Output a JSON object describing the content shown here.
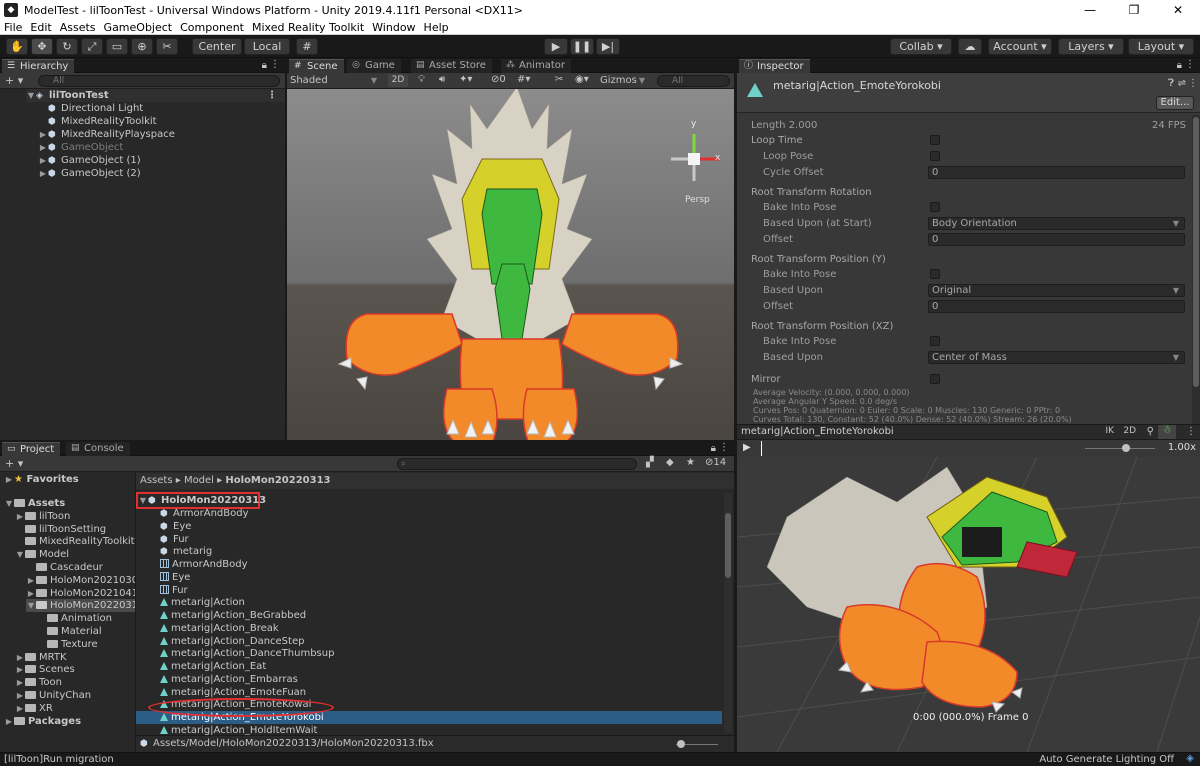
{
  "window": {
    "title": "ModelTest - lilToonTest - Universal Windows Platform - Unity 2019.4.11f1 Personal <DX11>",
    "minimize": "—",
    "maximize": "❐",
    "close": "✕"
  },
  "menu": [
    "File",
    "Edit",
    "Assets",
    "GameObject",
    "Component",
    "Mixed Reality Toolkit",
    "Window",
    "Help"
  ],
  "toolbar": {
    "center_label": "Center",
    "local_label": "Local",
    "collab_label": "Collab ▾",
    "account_label": "Account",
    "layers_label": "Layers",
    "layout_label": "Layout"
  },
  "hierarchy": {
    "tab": "Hierarchy",
    "add": "+ ▾",
    "search_placeholder": "All",
    "scene": "lilToonTest",
    "items": [
      {
        "label": "Directional Light",
        "level": 2,
        "arrow": "",
        "dim": false
      },
      {
        "label": "MixedRealityToolkit",
        "level": 2,
        "arrow": "",
        "dim": false
      },
      {
        "label": "MixedRealityPlayspace",
        "level": 2,
        "arrow": "▶",
        "dim": false
      },
      {
        "label": "GameObject",
        "level": 2,
        "arrow": "▶",
        "dim": true
      },
      {
        "label": "GameObject (1)",
        "level": 2,
        "arrow": "▶",
        "dim": false
      },
      {
        "label": "GameObject (2)",
        "level": 2,
        "arrow": "▶",
        "dim": false
      }
    ]
  },
  "scene_view": {
    "tabs": [
      "Scene",
      "Game",
      "Asset Store",
      "Animator"
    ],
    "shading": "Shaded",
    "mode_2d": "2D",
    "gizmos": "Gizmos",
    "search_placeholder": "All",
    "hidden_count": "0",
    "persp": "Persp",
    "axis_y": "y",
    "axis_x": "x"
  },
  "inspector": {
    "tab": "Inspector",
    "asset_name": "metarig|Action_EmoteYorokobi",
    "edit_button": "Edit...",
    "length_label": "Length",
    "length_value": "2.000",
    "fps": "24 FPS",
    "loop_time": "Loop Time",
    "loop_pose": "Loop Pose",
    "cycle_offset": "Cycle Offset",
    "cycle_offset_value": "0",
    "rot_header": "Root Transform Rotation",
    "bake_into_pose": "Bake Into Pose",
    "based_upon_start": "Based Upon (at Start)",
    "rot_based_value": "Body Orientation",
    "offset": "Offset",
    "rot_offset_value": "0",
    "posy_header": "Root Transform Position (Y)",
    "based_upon": "Based Upon",
    "posy_based_value": "Original",
    "posy_offset_value": "0",
    "posxz_header": "Root Transform Position (XZ)",
    "posxz_based_value": "Center of Mass",
    "mirror": "Mirror",
    "info": [
      "Average Velocity: (0.000, 0.000, 0.000)",
      "Average Angular Y Speed: 0.0 deg/s",
      "Curves Pos: 0 Quaternion: 0 Euler: 0 Scale: 0 Muscles: 130 Generic: 0 PPtr: 0",
      "Curves Total: 130, Constant: 52 (40.0%) Dense: 52 (40.0%) Stream: 26 (20.0%)"
    ]
  },
  "preview": {
    "title": "metarig|Action_EmoteYorokobi",
    "ik": "IK",
    "mode_2d": "2D",
    "speed": "1.00x",
    "timecode": "0:00 (000.0%) Frame 0"
  },
  "project": {
    "tabs": [
      "Project",
      "Console"
    ],
    "add": "+ ▾",
    "count": "14",
    "breadcrumb": [
      "Assets",
      "Model",
      "HoloMon20220313"
    ],
    "favorites": "Favorites",
    "tree": [
      {
        "label": "Assets",
        "level": 0,
        "arrow": "▼",
        "bold": true
      },
      {
        "label": "lilToon",
        "level": 1,
        "arrow": "▶"
      },
      {
        "label": "lilToonSetting",
        "level": 1,
        "arrow": ""
      },
      {
        "label": "MixedRealityToolkit.",
        "level": 1,
        "arrow": ""
      },
      {
        "label": "Model",
        "level": 1,
        "arrow": "▼"
      },
      {
        "label": "Cascadeur",
        "level": 2,
        "arrow": ""
      },
      {
        "label": "HoloMon2021030",
        "level": 2,
        "arrow": "▶"
      },
      {
        "label": "HoloMon2021041",
        "level": 2,
        "arrow": "▶"
      },
      {
        "label": "HoloMon2022031",
        "level": 2,
        "arrow": "▼",
        "selected": true
      },
      {
        "label": "Animation",
        "level": 3,
        "arrow": ""
      },
      {
        "label": "Material",
        "level": 3,
        "arrow": ""
      },
      {
        "label": "Texture",
        "level": 3,
        "arrow": ""
      },
      {
        "label": "MRTK",
        "level": 1,
        "arrow": "▶"
      },
      {
        "label": "Scenes",
        "level": 1,
        "arrow": "▶"
      },
      {
        "label": "Toon",
        "level": 1,
        "arrow": "▶"
      },
      {
        "label": "UnityChan",
        "level": 1,
        "arrow": "▶"
      },
      {
        "label": "XR",
        "level": 1,
        "arrow": "▶"
      },
      {
        "label": "Packages",
        "level": 0,
        "arrow": "▶",
        "bold": true
      }
    ],
    "root_asset": "HoloMon20220313",
    "assets": [
      {
        "label": "ArmorAndBody",
        "icon": "cube"
      },
      {
        "label": "Eye",
        "icon": "cube"
      },
      {
        "label": "Fur",
        "icon": "cube"
      },
      {
        "label": "metarig",
        "icon": "cube"
      },
      {
        "label": "ArmorAndBody",
        "icon": "mesh"
      },
      {
        "label": "Eye",
        "icon": "mesh"
      },
      {
        "label": "Fur",
        "icon": "mesh"
      },
      {
        "label": "metarig|Action",
        "icon": "anim"
      },
      {
        "label": "metarig|Action_BeGrabbed",
        "icon": "anim"
      },
      {
        "label": "metarig|Action_Break",
        "icon": "anim"
      },
      {
        "label": "metarig|Action_DanceStep",
        "icon": "anim"
      },
      {
        "label": "metarig|Action_DanceThumbsup",
        "icon": "anim"
      },
      {
        "label": "metarig|Action_Eat",
        "icon": "anim"
      },
      {
        "label": "metarig|Action_Embarras",
        "icon": "anim"
      },
      {
        "label": "metarig|Action_EmoteFuan",
        "icon": "anim"
      },
      {
        "label": "metarig|Action_EmoteKowai",
        "icon": "anim"
      },
      {
        "label": "metarig|Action_EmoteYorokobi",
        "icon": "anim",
        "selected": true
      },
      {
        "label": "metarig|Action_HoldItemWait",
        "icon": "anim"
      }
    ],
    "path": "Assets/Model/HoloMon20220313/HoloMon20220313.fbx"
  },
  "status": {
    "message": "[lilToon]Run migration",
    "right": "Auto Generate Lighting Off"
  },
  "colors": {
    "accent": "#2c5d87",
    "selection": "#2c5d87",
    "highlight_red": "#e03030"
  }
}
